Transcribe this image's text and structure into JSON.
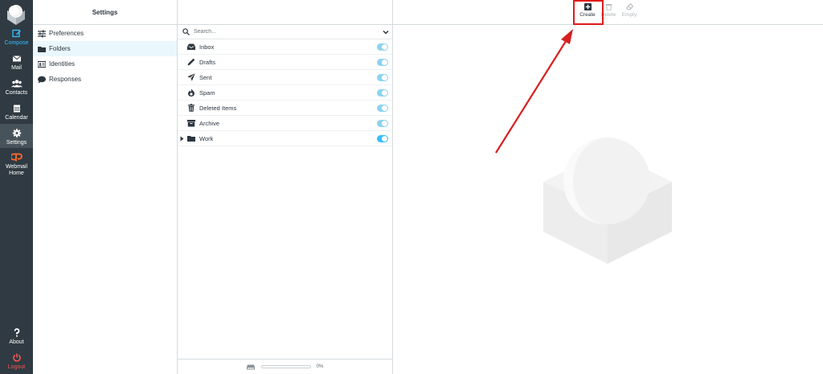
{
  "nav": {
    "items": [
      {
        "key": "compose",
        "label": "Compose",
        "icon": "compose-icon"
      },
      {
        "key": "mail",
        "label": "Mail",
        "icon": "envelope-icon"
      },
      {
        "key": "contacts",
        "label": "Contacts",
        "icon": "contacts-icon"
      },
      {
        "key": "calendar",
        "label": "Calendar",
        "icon": "calendar-icon"
      },
      {
        "key": "settings",
        "label": "Settings",
        "icon": "gear-icon"
      },
      {
        "key": "webmail_home",
        "label_line1": "Webmail",
        "label_line2": "Home",
        "icon": "cpanel-icon"
      },
      {
        "key": "about",
        "label": "About",
        "icon": "question-icon"
      },
      {
        "key": "logout",
        "label": "Logout",
        "icon": "power-icon"
      }
    ]
  },
  "settings": {
    "header": "Settings",
    "items": [
      {
        "label": "Preferences",
        "icon": "sliders-icon"
      },
      {
        "label": "Folders",
        "icon": "folder-icon",
        "selected": true
      },
      {
        "label": "Identities",
        "icon": "id-card-icon"
      },
      {
        "label": "Responses",
        "icon": "speech-bubble-icon"
      }
    ]
  },
  "folders": {
    "search_placeholder": "Search...",
    "items": [
      {
        "label": "Inbox",
        "icon": "inbox-icon",
        "subscribed": true
      },
      {
        "label": "Drafts",
        "icon": "pencil-icon",
        "subscribed": true
      },
      {
        "label": "Sent",
        "icon": "paper-plane-icon",
        "subscribed": true
      },
      {
        "label": "Spam",
        "icon": "fire-icon",
        "subscribed": true
      },
      {
        "label": "Deleted Items",
        "icon": "trash-icon",
        "subscribed": true
      },
      {
        "label": "Archive",
        "icon": "archive-icon",
        "subscribed": true
      },
      {
        "label": "Work",
        "icon": "folder-icon",
        "subscribed": true,
        "expandable": true
      }
    ],
    "quota": {
      "text": "0%",
      "used_fraction": 0
    }
  },
  "toolbar": {
    "create": "Create",
    "delete": "Delete",
    "empty": "Empty"
  },
  "colors": {
    "nav_bg": "#2f3a42",
    "accent": "#37beff",
    "logout": "#ff5552",
    "highlight": "#e11a1a"
  }
}
